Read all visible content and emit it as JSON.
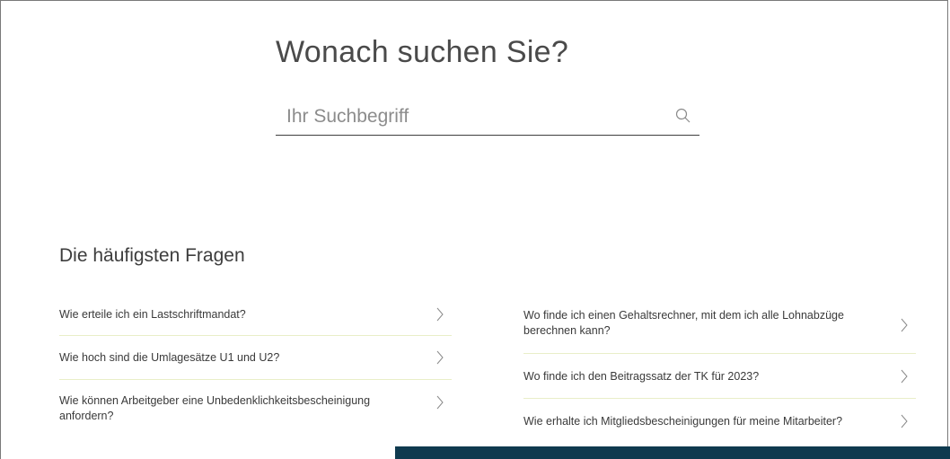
{
  "search": {
    "title": "Wonach suchen Sie?",
    "placeholder": "Ihr Suchbegriff"
  },
  "faq": {
    "heading": "Die häufigsten Fragen",
    "left": [
      "Wie erteile ich ein Lastschriftmandat?",
      "Wie hoch sind die Umlagesätze U1 und U2?",
      "Wie können Arbeitgeber eine Unbedenklichkeitsbescheinigung anfordern?"
    ],
    "right": [
      "Wo finde ich einen Gehaltsrechner, mit dem ich alle Lohnabzüge berechnen kann?",
      "Wo finde ich den Beitragssatz der TK für 2023?",
      "Wie erhalte ich Mitgliedsbescheinigungen für meine Mitarbeiter?"
    ]
  },
  "icons": {
    "search": "search-icon",
    "chevron": "chevron-right-icon"
  },
  "colors": {
    "divider": "#e9eec8",
    "bottom_bar": "#0f3a4f"
  }
}
